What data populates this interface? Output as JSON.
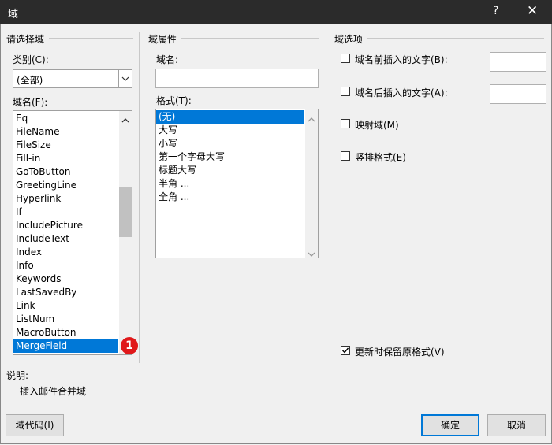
{
  "window": {
    "title": "域",
    "help": "?",
    "close": "✕"
  },
  "choose": {
    "header": "请选择域",
    "category_label": "类别(C):",
    "category_value": "(全部)",
    "fieldnames_label": "域名(F):",
    "fields": [
      "Eq",
      "FileName",
      "FileSize",
      "Fill-in",
      "GoToButton",
      "GreetingLine",
      "Hyperlink",
      "If",
      "IncludePicture",
      "IncludeText",
      "Index",
      "Info",
      "Keywords",
      "LastSavedBy",
      "Link",
      "ListNum",
      "MacroButton",
      "MergeField"
    ],
    "selected_field": "MergeField",
    "badge": "1"
  },
  "props": {
    "header": "域属性",
    "fieldname_label": "域名:",
    "fieldname_value": "",
    "format_label": "格式(T):",
    "formats": [
      "(无)",
      "大写",
      "小写",
      "第一个字母大写",
      "标题大写",
      "半角 ...",
      "全角 ..."
    ],
    "selected_format": "(无)"
  },
  "options": {
    "header": "域选项",
    "before_text_label": "域名前插入的文字(B):",
    "after_text_label": "域名后插入的文字(A):",
    "mapped_label": "映射域(M)",
    "vertical_label": "竖排格式(E)",
    "preserve_label": "更新时保留原格式(V)",
    "before_checked": false,
    "after_checked": false,
    "mapped_checked": false,
    "vertical_checked": false,
    "preserve_checked": true
  },
  "description": {
    "label": "说明:",
    "text": "插入邮件合并域"
  },
  "buttons": {
    "field_codes": "域代码(I)",
    "ok": "确定",
    "cancel": "取消"
  }
}
